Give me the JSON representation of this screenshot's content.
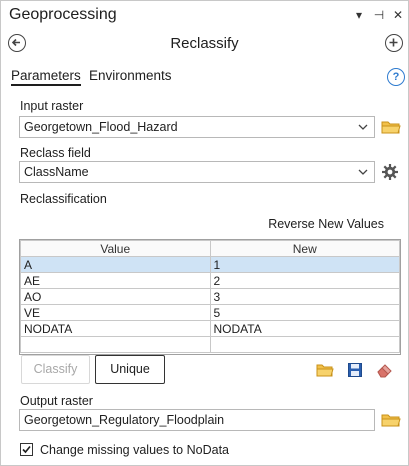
{
  "pane": {
    "title": "Geoprocessing",
    "controls": {
      "options": "▾",
      "pin": "⊣",
      "close": "✕"
    }
  },
  "tool": {
    "title": "Reclassify"
  },
  "tabs": [
    {
      "label": "Parameters",
      "active": true
    },
    {
      "label": "Environments",
      "active": false
    }
  ],
  "input_raster": {
    "label": "Input raster",
    "value": "Georgetown_Flood_Hazard"
  },
  "reclass_field": {
    "label": "Reclass field",
    "value": "ClassName"
  },
  "reclassification": {
    "label": "Reclassification",
    "reverse_label": "Reverse New Values",
    "columns": [
      "Value",
      "New"
    ],
    "rows": [
      {
        "value": "A",
        "new": "1",
        "selected": true
      },
      {
        "value": "AE",
        "new": "2"
      },
      {
        "value": "AO",
        "new": "3"
      },
      {
        "value": "VE",
        "new": "5"
      },
      {
        "value": "NODATA",
        "new": "NODATA"
      },
      {
        "value": "",
        "new": ""
      }
    ]
  },
  "buttons": {
    "classify": "Classify",
    "unique": "Unique"
  },
  "output_raster": {
    "label": "Output raster",
    "value": "Georgetown_Regulatory_Floodplain"
  },
  "missing_nodata": {
    "label": "Change missing values to NoData",
    "checked": true
  },
  "colors": {
    "accent": "#2e7bcf",
    "selected_row": "#cfe3f5",
    "folder": "#e0a828",
    "save": "#2a5fb0",
    "eraser": "#d9736a"
  }
}
